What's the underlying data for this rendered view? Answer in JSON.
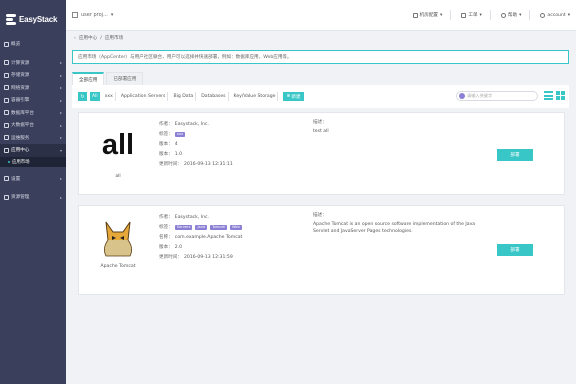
{
  "brand": {
    "name": "EasyStack"
  },
  "sidebar": {
    "items": [
      {
        "label": "概览",
        "has_arrow": false
      },
      {
        "label": "计算资源",
        "has_arrow": true
      },
      {
        "label": "存储资源",
        "has_arrow": true
      },
      {
        "label": "网络资源",
        "has_arrow": true
      },
      {
        "label": "容器引擎",
        "has_arrow": true
      },
      {
        "label": "数据库平台",
        "has_arrow": true
      },
      {
        "label": "大数据平台",
        "has_arrow": true
      },
      {
        "label": "运维服务",
        "has_arrow": true
      },
      {
        "label": "应用中心",
        "has_arrow": true,
        "active": true
      },
      {
        "label": "设置",
        "has_arrow": true
      },
      {
        "label": "资源管理",
        "has_arrow": true
      }
    ],
    "sub_item": "应用市场"
  },
  "topbar": {
    "project": "user proj...",
    "items": [
      "机房配置",
      "工单",
      "帮助",
      "account"
    ]
  },
  "breadcrumb": [
    "应用中心",
    "应用市场"
  ],
  "tip": "应用市场（AppCenter）与用户社区联合，用户可以选择并快速部署，例如：数据库应用，Web应用等。",
  "tabs": [
    {
      "label": "全部应用",
      "active": true
    },
    {
      "label": "已部署应用",
      "active": false
    }
  ],
  "filters": {
    "refresh_icon": "refresh-icon",
    "chips": [
      "All",
      "xxx",
      "Application Servers",
      "Big Data",
      "Databases",
      "Key/Value Storage"
    ],
    "active_chip": "All",
    "new_button": "新建",
    "search_placeholder": "请输入关键字"
  },
  "cards": [
    {
      "name": "all",
      "logo_text": "all",
      "meta": [
        {
          "key": "作者：",
          "value": "Easystack, Inc."
        },
        {
          "key": "标签：",
          "value": "",
          "tags": [
            "xxx"
          ]
        },
        {
          "key": "版本：",
          "value": "4"
        },
        {
          "key": "版本：",
          "value": "1.0"
        },
        {
          "key": "更新时间：",
          "value": "2016-09-13 12:31:11"
        }
      ],
      "desc_label": "描述：",
      "desc": "test all",
      "button": "部署"
    },
    {
      "name": "Apache Tomcat",
      "logo_text": "",
      "meta": [
        {
          "key": "作者：",
          "value": "Easystack, Inc."
        },
        {
          "key": "标签：",
          "value": "",
          "tags": [
            "Servers",
            "Java",
            "Tomcat",
            "Web"
          ]
        },
        {
          "key": "名称：",
          "value": "com.example.Apache Tomcat"
        },
        {
          "key": "版本：",
          "value": "2.0"
        },
        {
          "key": "更新时间：",
          "value": "2016-09-13 12:31:59"
        }
      ],
      "desc_label": "描述：",
      "desc": "Apache Tomcat is an open source software implementation of the Java Servlet and JavaServer Pages technologies.",
      "button": "部署"
    }
  ]
}
